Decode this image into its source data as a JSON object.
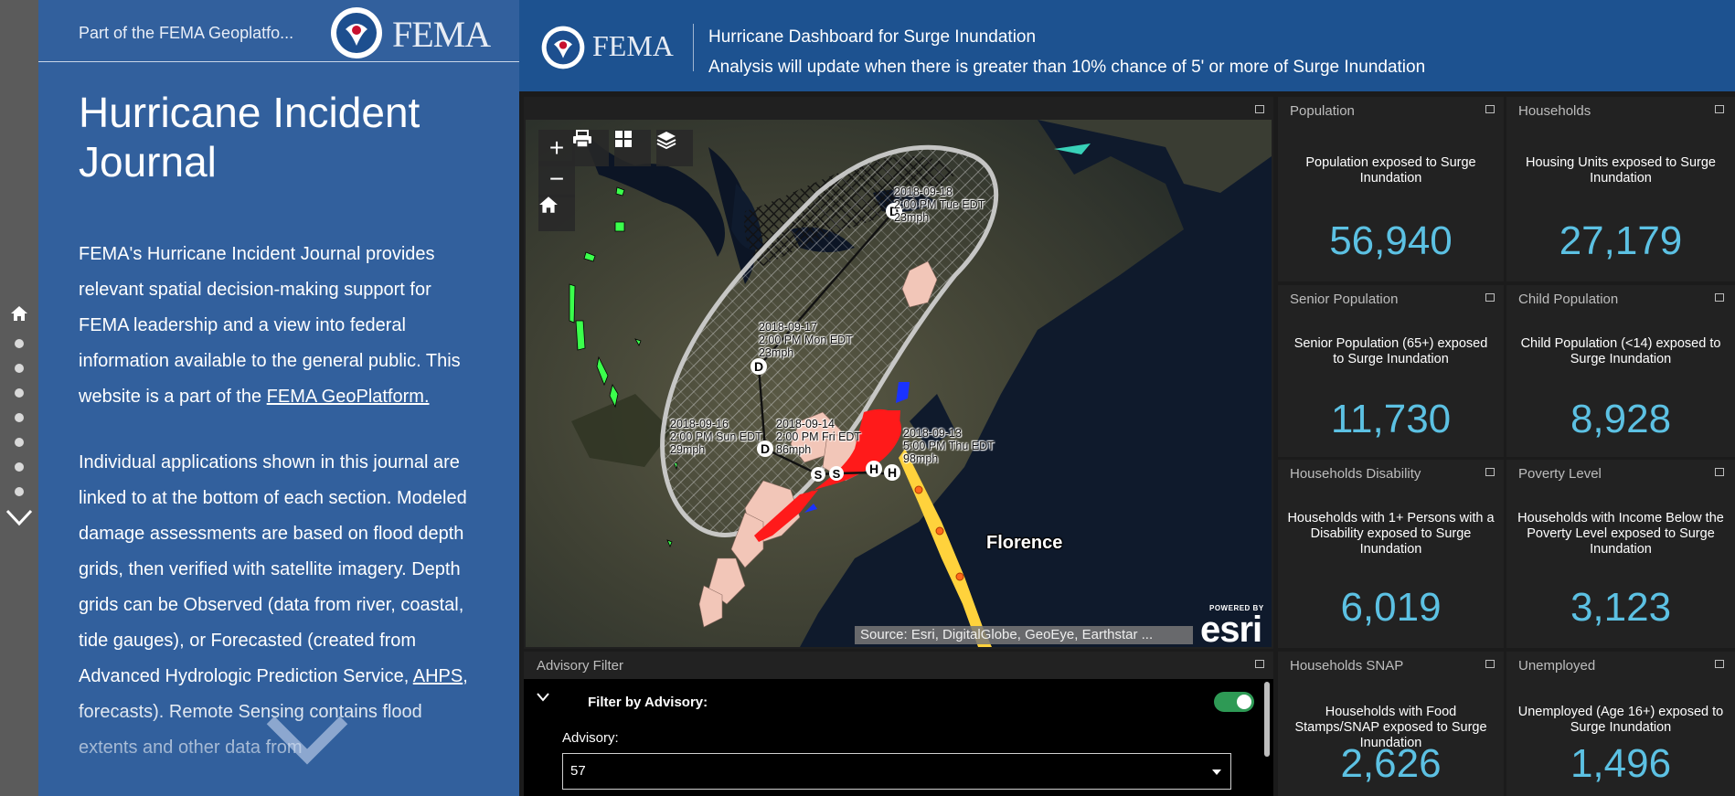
{
  "story": {
    "part_of": "Part of the FEMA Geoplatfo...",
    "fema_wordmark": "FEMA",
    "title": "Hurricane Incident Journal",
    "p1_text": "FEMA's Hurricane Incident Journal provides relevant spatial decision-making support for FEMA leadership and a view into federal information available to the general public. This website is a part of the ",
    "p1_link": "FEMA GeoPlatform.",
    "p2_text_a": "Individual applications shown in this journal are linked to at the bottom of each section. Modeled damage assessments are based on flood depth grids, then verified with satellite imagery. Depth grids can be Observed (data from river, coastal, tide gauges), or Forecasted (created from Advanced Hydrologic Prediction Service, ",
    "p2_link": "AHPS",
    "p2_text_b": ", forecasts). Remote Sensing contains flood extents and other data from"
  },
  "dashboard": {
    "fema_wordmark": "FEMA",
    "title": "Hurricane Dashboard for Surge Inundation",
    "subtitle": "Analysis will update when there is greater than 10% chance of 5' or more of Surge Inundation"
  },
  "map": {
    "controls": {
      "zoom_in": "+",
      "zoom_out": "−"
    },
    "track_points": [
      {
        "label": "2018-09-18\n2:00 PM Tue EDT\n23mph",
        "marker": "D"
      },
      {
        "label": "2018-09-17\n2:00 PM Mon EDT\n23mph",
        "marker": "D"
      },
      {
        "label": "2018-09-16\n2:00 PM Sun EDT\n29mph",
        "marker": "D"
      },
      {
        "label": "2018-09-14\n2:00 PM Fri EDT\n86mph",
        "marker": "S"
      },
      {
        "label": "2018-09-13\n5:00 PM Thu EDT\n98mph",
        "marker": "H"
      }
    ],
    "extra_markers": [
      "S",
      "H"
    ],
    "storm_name": "Florence",
    "attribution": "Source: Esri, DigitalGlobe, GeoEye, Earthstar ...",
    "powered_by": "POWERED BY",
    "esri": "esri"
  },
  "filter": {
    "header": "Advisory Filter",
    "label": "Filter by Advisory:",
    "toggle_on": true,
    "advisory_label": "Advisory:",
    "advisory_value": "57"
  },
  "cards": [
    {
      "title": "Population",
      "desc": "Population exposed to Surge Inundation",
      "value": "56,940"
    },
    {
      "title": "Households",
      "desc": "Housing Units exposed to Surge Inundation",
      "value": "27,179"
    },
    {
      "title": "Senior Population",
      "desc": "Senior Population (65+) exposed to Surge Inundation",
      "value": "11,730"
    },
    {
      "title": "Child Population",
      "desc": "Child Population (<14) exposed to Surge Inundation",
      "value": "8,928"
    },
    {
      "title": "Households Disability",
      "desc": "Households with 1+ Persons with a Disability exposed to Surge Inundation",
      "value": "6,019"
    },
    {
      "title": "Poverty Level",
      "desc": "Households with Income Below the Poverty Level exposed to Surge Inundation",
      "value": "3,123"
    },
    {
      "title": "Households SNAP",
      "desc": "Households with Food Stamps/SNAP exposed to Surge Inundation",
      "value": "2,626"
    },
    {
      "title": "Unemployed",
      "desc": "Unemployed (Age 16+) exposed to Surge Inundation",
      "value": "1,496"
    }
  ],
  "colors": {
    "story_bg": "#32609d",
    "header_bg": "#1d5290",
    "card_bg": "#222222",
    "value_blue": "#5cc1e3",
    "toggle_green": "#2e9a55",
    "surge_red": "#ff1a1a",
    "track_yellow": "#ffd23c"
  }
}
